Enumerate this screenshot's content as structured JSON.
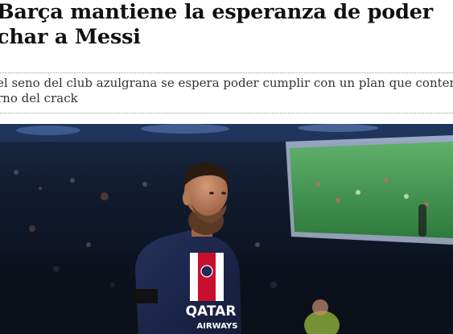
{
  "article": {
    "headline_line1": "Barça mantiene la esperanza de poder",
    "headline_line2": "char a Messi",
    "subtitle_line1": "el seno del club azulgrana se espera poder cumplir con un plan que contempl",
    "subtitle_line2": "rno del crack"
  },
  "photo": {
    "shirt_logo": "QATAR",
    "shirt_logo_sub": "AIRWAYS"
  }
}
